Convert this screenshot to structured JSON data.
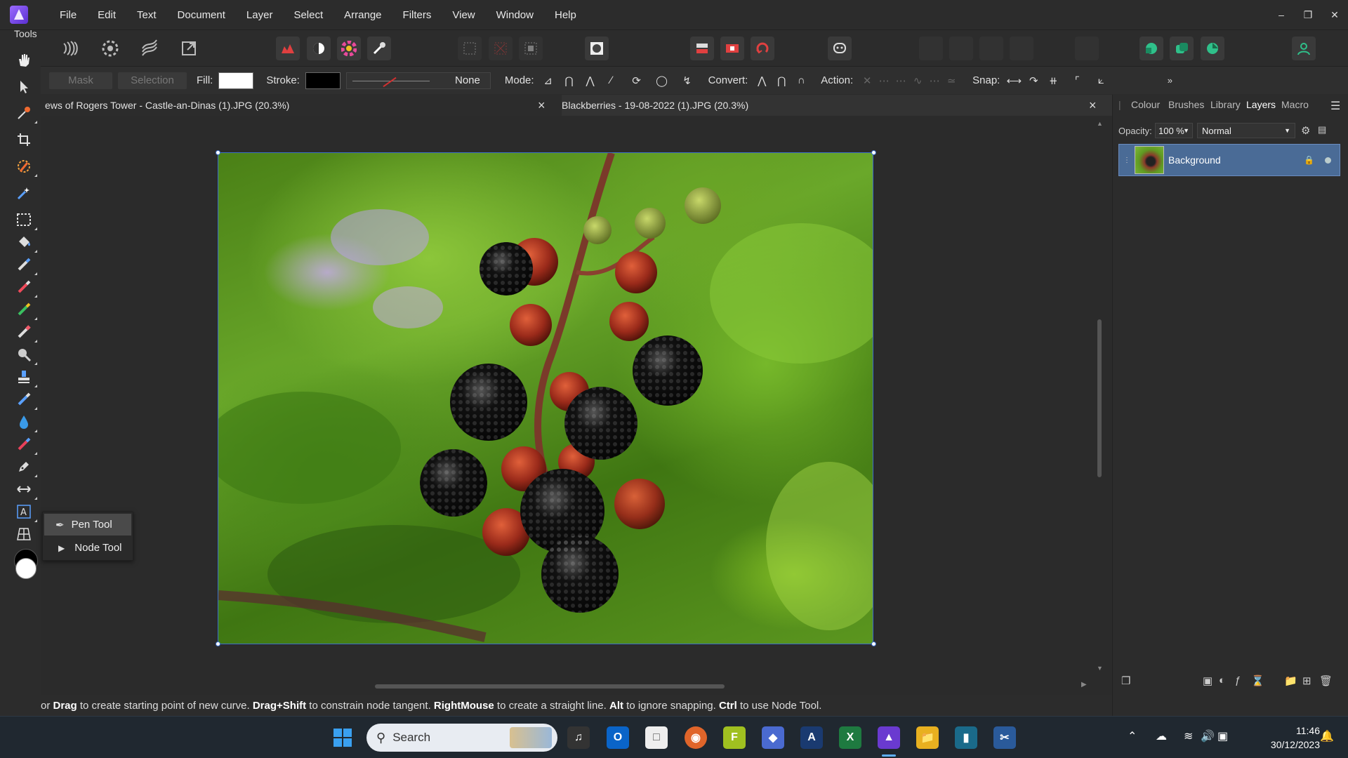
{
  "menu": [
    "File",
    "Edit",
    "Text",
    "Document",
    "Layer",
    "Select",
    "Arrange",
    "Filters",
    "View",
    "Window",
    "Help"
  ],
  "tools_label": "Tools",
  "context": {
    "mask": "Mask",
    "selection": "Selection",
    "fill_label": "Fill:",
    "stroke_label": "Stroke:",
    "stroke_style": "None",
    "mode_label": "Mode:",
    "convert_label": "Convert:",
    "action_label": "Action:",
    "snap_label": "Snap:",
    "fill_color": "#ffffff",
    "stroke_color": "#000000"
  },
  "tabs": [
    {
      "title": "ews of Rogers Tower - Castle-an-Dinas (1).JPG (20.3%)"
    },
    {
      "title": "Blackberries - 19-08-2022 (1).JPG (20.3%)"
    }
  ],
  "flyout": {
    "items": [
      "Pen Tool",
      "Node Tool"
    ],
    "selected": "Pen Tool"
  },
  "panel": {
    "tabs": [
      "Colour",
      "Brushes",
      "Library",
      "Layers",
      "Macro"
    ],
    "active_tab": "Layers",
    "opacity_label": "Opacity:",
    "opacity_value": "100 %",
    "blend_mode": "Normal",
    "layers": [
      {
        "name": "Background"
      }
    ]
  },
  "status": {
    "p1": "or ",
    "k1": "Drag",
    "p2": " to create starting point of new curve. ",
    "k2": "Drag+Shift",
    "p3": " to constrain node tangent. ",
    "k3": "RightMouse",
    "p4": " to create a straight line. ",
    "k4": "Alt",
    "p5": " to ignore snapping. ",
    "k5": "Ctrl",
    "p6": " to use Node Tool."
  },
  "taskbar": {
    "search_placeholder": "Search",
    "time": "11:46",
    "date": "30/12/2023"
  },
  "colors": {
    "accent": "#4a6b96",
    "selection": "#3b6ec8"
  }
}
